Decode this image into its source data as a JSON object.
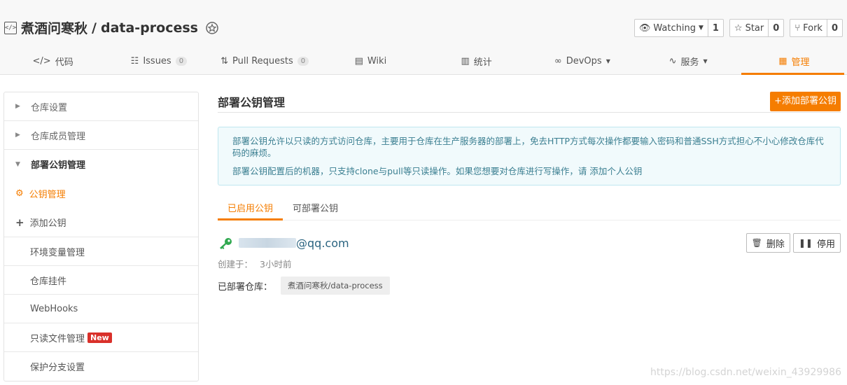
{
  "repo": {
    "owner": "煮酒问寒秋",
    "separator": " / ",
    "name": "data-process"
  },
  "actions": {
    "watching": {
      "label": "Watching",
      "count": "1"
    },
    "star": {
      "label": "Star",
      "count": "0"
    },
    "fork": {
      "label": "Fork",
      "count": "0"
    }
  },
  "tabs": [
    {
      "label": "代码",
      "icon": "code-icon"
    },
    {
      "label": "Issues",
      "count": "0",
      "icon": "issues-icon"
    },
    {
      "label": "Pull Requests",
      "count": "0",
      "icon": "pull-request-icon"
    },
    {
      "label": "Wiki",
      "icon": "wiki-icon"
    },
    {
      "label": "统计",
      "icon": "stats-icon"
    },
    {
      "label": "DevOps",
      "icon": "devops-icon"
    },
    {
      "label": "服务",
      "icon": "service-icon"
    },
    {
      "label": "管理",
      "icon": "manage-icon"
    }
  ],
  "sidebar": {
    "repo_settings": "仓库设置",
    "members": "仓库成员管理",
    "deploy_keys": "部署公钥管理",
    "key_manage": "公钥管理",
    "add_key": "添加公钥",
    "env_vars": "环境变量管理",
    "plugins": "仓库挂件",
    "webhooks": "WebHooks",
    "readonly": "只读文件管理",
    "new_badge": "New",
    "branch_protect": "保护分支设置"
  },
  "main": {
    "title": "部署公钥管理",
    "add_button": "+添加部署公钥",
    "info_line1": "部署公钥允许以只读的方式访问仓库，主要用于仓库在生产服务器的部署上，免去HTTP方式每次操作都要输入密码和普通SSH方式担心不小心修改仓库代码的麻烦。",
    "info_line2": "部署公钥配置后的机器，只支持clone与pull等只读操作。如果您想要对仓库进行写操作，请 添加个人公钥",
    "sub_tabs": {
      "enabled": "已启用公钥",
      "deployable": "可部署公钥"
    },
    "key": {
      "email_suffix": "@qq.com",
      "created_label": "创建于：",
      "created_value": "3小时前",
      "deployed_label": "已部署仓库：",
      "deployed_repo": "煮酒问寒秋/data-process",
      "delete_label": "删除",
      "disable_label": "停用"
    }
  },
  "watermark": "https://blog.csdn.net/weixin_43929986",
  "colors": {
    "accent": "#f57d00",
    "key_green": "#2fa84f",
    "new_badge": "#d9302a"
  }
}
